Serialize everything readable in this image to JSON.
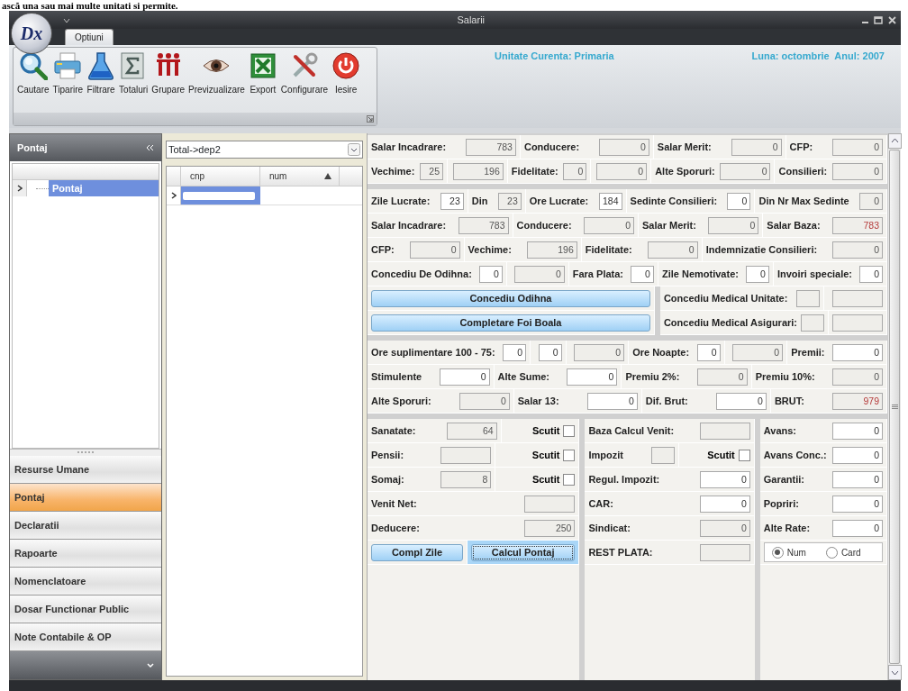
{
  "document_text": "ască una sau mai multe unitati si permite.",
  "window": {
    "title": "Salarii",
    "logo_text": "Dx"
  },
  "ribbon": {
    "tabs": [
      {
        "label": "Optiuni",
        "selected": true
      }
    ],
    "buttons": [
      "Cautare",
      "Tiparire",
      "Filtrare",
      "Totaluri",
      "Grupare",
      "Previzualizare",
      "Export",
      "Configurare",
      "Iesire"
    ],
    "unit": "Unitate Curenta: Primaria",
    "period": "Luna: octombrie  Anul: 2007"
  },
  "sidebar": {
    "title": "Pontaj",
    "tree": [
      {
        "label": "Pontaj",
        "selected": true
      }
    ],
    "nav": [
      {
        "label": "Resurse Umane",
        "selected": false
      },
      {
        "label": "Pontaj",
        "selected": true
      },
      {
        "label": "Declaratii",
        "selected": false
      },
      {
        "label": "Rapoarte",
        "selected": false
      },
      {
        "label": "Nomenclatoare",
        "selected": false
      },
      {
        "label": "Dosar Functionar Public",
        "selected": false
      },
      {
        "label": "Note Contabile & OP",
        "selected": false
      }
    ]
  },
  "list": {
    "filter": "Total->dep2",
    "columns": [
      "cnp",
      "num"
    ],
    "rows": [
      {
        "selected": true
      }
    ]
  },
  "form": {
    "sections": [
      {
        "blocks": [
          {
            "rows": [
              {
                "groups": [
                  {
                    "items": [
                      {
                        "kind": "label",
                        "text": "Salar Incadrare:"
                      },
                      {
                        "kind": "field",
                        "value": "783",
                        "readonly": true
                      }
                    ]
                  },
                  {
                    "items": [
                      {
                        "kind": "label",
                        "text": "Conducere:"
                      },
                      {
                        "kind": "field",
                        "value": "0",
                        "readonly": true
                      }
                    ]
                  },
                  {
                    "items": [
                      {
                        "kind": "label",
                        "text": "Salar Merit:"
                      },
                      {
                        "kind": "field",
                        "value": "0",
                        "readonly": true
                      }
                    ]
                  },
                  {
                    "items": [
                      {
                        "kind": "label",
                        "text": "CFP:"
                      },
                      {
                        "kind": "field",
                        "value": "0",
                        "readonly": true
                      }
                    ]
                  }
                ]
              },
              {
                "groups": [
                  {
                    "items": [
                      {
                        "kind": "label",
                        "text": "Vechime:"
                      },
                      {
                        "kind": "small_field",
                        "value": "25",
                        "readonly": true
                      }
                    ]
                  },
                  {
                    "items": [
                      {
                        "kind": "field",
                        "value": "196",
                        "readonly": true
                      }
                    ]
                  },
                  {
                    "items": [
                      {
                        "kind": "label",
                        "text": "Fidelitate:"
                      },
                      {
                        "kind": "small_field",
                        "value": "0",
                        "readonly": true
                      }
                    ]
                  },
                  {
                    "items": [
                      {
                        "kind": "field",
                        "value": "0",
                        "readonly": true
                      }
                    ]
                  },
                  {
                    "items": [
                      {
                        "kind": "label",
                        "text": "Alte Sporuri:"
                      },
                      {
                        "kind": "field",
                        "value": "0",
                        "readonly": true
                      }
                    ]
                  },
                  {
                    "items": [
                      {
                        "kind": "label",
                        "text": "Consilieri:"
                      },
                      {
                        "kind": "field",
                        "value": "0",
                        "readonly": true
                      }
                    ]
                  }
                ]
              }
            ]
          }
        ]
      },
      {
        "blocks": [
          {
            "rows": [
              {
                "groups": [
                  {
                    "items": [
                      {
                        "kind": "label",
                        "text": "Zile Lucrate:"
                      },
                      {
                        "kind": "small_field",
                        "value": "23",
                        "readonly": false
                      }
                    ]
                  },
                  {
                    "items": [
                      {
                        "kind": "label",
                        "text": "Din"
                      },
                      {
                        "kind": "small_field",
                        "value": "23",
                        "readonly": true
                      }
                    ]
                  },
                  {
                    "items": [
                      {
                        "kind": "label",
                        "text": "Ore Lucrate:"
                      },
                      {
                        "kind": "small_field",
                        "value": "184",
                        "readonly": false
                      }
                    ]
                  },
                  {
                    "items": [
                      {
                        "kind": "label",
                        "text": "Sedinte Consilieri:"
                      },
                      {
                        "kind": "small_field",
                        "value": "0",
                        "readonly": false
                      }
                    ]
                  },
                  {
                    "items": [
                      {
                        "kind": "label",
                        "text": "Din Nr Max Sedinte"
                      },
                      {
                        "kind": "small_field",
                        "value": "0",
                        "readonly": true
                      }
                    ]
                  }
                ]
              },
              {
                "groups": [
                  {
                    "items": [
                      {
                        "kind": "label",
                        "text": "Salar Incadrare:"
                      },
                      {
                        "kind": "field",
                        "value": "783",
                        "readonly": true
                      }
                    ]
                  },
                  {
                    "items": [
                      {
                        "kind": "label",
                        "text": "Conducere:"
                      },
                      {
                        "kind": "field",
                        "value": "0",
                        "readonly": true
                      }
                    ]
                  },
                  {
                    "items": [
                      {
                        "kind": "label",
                        "text": "Salar Merit:"
                      },
                      {
                        "kind": "field",
                        "value": "0",
                        "readonly": true
                      }
                    ]
                  },
                  {
                    "items": [
                      {
                        "kind": "label",
                        "text": "Salar Baza:"
                      },
                      {
                        "kind": "field",
                        "value": "783",
                        "readonly": true,
                        "emphasis": true
                      }
                    ]
                  }
                ]
              },
              {
                "groups": [
                  {
                    "items": [
                      {
                        "kind": "label",
                        "text": "CFP:"
                      },
                      {
                        "kind": "field",
                        "value": "0",
                        "readonly": true
                      }
                    ]
                  },
                  {
                    "items": [
                      {
                        "kind": "label",
                        "text": "Vechime:"
                      },
                      {
                        "kind": "field",
                        "value": "196",
                        "readonly": true
                      }
                    ]
                  },
                  {
                    "items": [
                      {
                        "kind": "label",
                        "text": "Fidelitate:"
                      },
                      {
                        "kind": "field",
                        "value": "0",
                        "readonly": true
                      }
                    ]
                  },
                  {
                    "items": [
                      {
                        "kind": "label",
                        "text": "Indemnizatie Consilieri:"
                      },
                      {
                        "kind": "field",
                        "value": "0",
                        "readonly": true
                      }
                    ]
                  }
                ]
              },
              {
                "groups": [
                  {
                    "items": [
                      {
                        "kind": "label",
                        "text": "Concediu De Odihna:"
                      },
                      {
                        "kind": "small_field",
                        "value": "0",
                        "readonly": false
                      }
                    ]
                  },
                  {
                    "items": [
                      {
                        "kind": "field",
                        "value": "0",
                        "readonly": true
                      }
                    ]
                  },
                  {
                    "items": [
                      {
                        "kind": "label",
                        "text": "Fara Plata:"
                      },
                      {
                        "kind": "small_field",
                        "value": "0",
                        "readonly": false
                      }
                    ]
                  },
                  {
                    "items": [
                      {
                        "kind": "label",
                        "text": "Zile Nemotivate:"
                      },
                      {
                        "kind": "small_field",
                        "value": "0",
                        "readonly": false
                      }
                    ]
                  },
                  {
                    "items": [
                      {
                        "kind": "label",
                        "text": "Invoiri speciale:"
                      },
                      {
                        "kind": "small_field",
                        "value": "0",
                        "readonly": false
                      }
                    ]
                  }
                ]
              }
            ]
          },
          {
            "columns": [
              {
                "rows": [
                  {
                    "groups": [
                      {
                        "items": [
                          {
                            "kind": "button",
                            "label": "Concediu Odihna",
                            "focused": false
                          }
                        ]
                      }
                    ]
                  },
                  {
                    "groups": [
                      {
                        "items": [
                          {
                            "kind": "button",
                            "label": "Completare Foi Boala",
                            "focused": false
                          }
                        ]
                      }
                    ]
                  }
                ]
              },
              {
                "rows": [
                  {
                    "groups": [
                      {
                        "items": [
                          {
                            "kind": "label",
                            "text": "Concediu Medical Unitate:"
                          },
                          {
                            "kind": "small_field",
                            "readonly": true
                          }
                        ]
                      },
                      {
                        "items": [
                          {
                            "kind": "field",
                            "readonly": true
                          }
                        ]
                      }
                    ]
                  },
                  {
                    "groups": [
                      {
                        "items": [
                          {
                            "kind": "label",
                            "text": "Concediu Medical Asigurari:"
                          },
                          {
                            "kind": "small_field",
                            "readonly": true
                          }
                        ]
                      },
                      {
                        "items": [
                          {
                            "kind": "field",
                            "readonly": true
                          }
                        ]
                      }
                    ]
                  }
                ]
              }
            ]
          }
        ]
      },
      {
        "blocks": [
          {
            "rows": [
              {
                "groups": [
                  {
                    "items": [
                      {
                        "kind": "label",
                        "text": "Ore suplimentare 100 - 75:"
                      },
                      {
                        "kind": "small_field",
                        "value": "0",
                        "readonly": false
                      }
                    ]
                  },
                  {
                    "items": [
                      {
                        "kind": "small_field",
                        "value": "0",
                        "readonly": false
                      }
                    ]
                  },
                  {
                    "items": [
                      {
                        "kind": "field",
                        "value": "0",
                        "readonly": true
                      }
                    ]
                  },
                  {
                    "items": [
                      {
                        "kind": "label",
                        "text": "Ore Noapte:"
                      },
                      {
                        "kind": "small_field",
                        "value": "0",
                        "readonly": false
                      }
                    ]
                  },
                  {
                    "items": [
                      {
                        "kind": "field",
                        "value": "0",
                        "readonly": true
                      }
                    ]
                  },
                  {
                    "items": [
                      {
                        "kind": "label",
                        "text": "Premii:"
                      },
                      {
                        "kind": "field",
                        "value": "0",
                        "readonly": false
                      }
                    ]
                  }
                ]
              },
              {
                "groups": [
                  {
                    "items": [
                      {
                        "kind": "label",
                        "text": "Stimulente"
                      },
                      {
                        "kind": "field",
                        "value": "0",
                        "readonly": false
                      }
                    ]
                  },
                  {
                    "items": [
                      {
                        "kind": "label",
                        "text": "Alte Sume:"
                      },
                      {
                        "kind": "field",
                        "value": "0",
                        "readonly": false
                      }
                    ]
                  },
                  {
                    "items": [
                      {
                        "kind": "label",
                        "text": "Premiu 2%:"
                      },
                      {
                        "kind": "field",
                        "value": "0",
                        "readonly": true
                      }
                    ]
                  },
                  {
                    "items": [
                      {
                        "kind": "label",
                        "text": "Premiu 10%:"
                      },
                      {
                        "kind": "field",
                        "value": "0",
                        "readonly": true
                      }
                    ]
                  }
                ]
              },
              {
                "groups": [
                  {
                    "items": [
                      {
                        "kind": "label",
                        "text": "Alte Sporuri:"
                      },
                      {
                        "kind": "field",
                        "value": "0",
                        "readonly": true
                      }
                    ]
                  },
                  {
                    "items": [
                      {
                        "kind": "label",
                        "text": "Salar 13:"
                      },
                      {
                        "kind": "field",
                        "value": "0",
                        "readonly": false
                      }
                    ]
                  },
                  {
                    "items": [
                      {
                        "kind": "label",
                        "text": "Dif. Brut:"
                      },
                      {
                        "kind": "field",
                        "value": "0",
                        "readonly": false
                      }
                    ]
                  },
                  {
                    "items": [
                      {
                        "kind": "label",
                        "text": "BRUT:"
                      },
                      {
                        "kind": "field",
                        "value": "979",
                        "readonly": true,
                        "emphasis": true
                      }
                    ]
                  }
                ]
              }
            ]
          }
        ]
      },
      {
        "blocks": [
          {
            "columns": [
              {
                "rows": [
                  {
                    "groups": [
                      {
                        "items": [
                          {
                            "kind": "label",
                            "text": "Sanatate:"
                          },
                          {
                            "kind": "field",
                            "value": "64",
                            "readonly": true
                          }
                        ]
                      },
                      {
                        "items": [
                          {
                            "kind": "checkbox",
                            "label": "Scutit",
                            "checked": false
                          }
                        ]
                      }
                    ]
                  },
                  {
                    "groups": [
                      {
                        "items": [
                          {
                            "kind": "label",
                            "text": "Pensii:"
                          },
                          {
                            "kind": "field",
                            "readonly": true
                          }
                        ]
                      },
                      {
                        "items": [
                          {
                            "kind": "checkbox",
                            "label": "Scutit",
                            "checked": false
                          }
                        ]
                      }
                    ]
                  },
                  {
                    "groups": [
                      {
                        "items": [
                          {
                            "kind": "label",
                            "text": "Somaj:"
                          },
                          {
                            "kind": "field",
                            "value": "8",
                            "readonly": true
                          }
                        ]
                      },
                      {
                        "items": [
                          {
                            "kind": "checkbox",
                            "label": "Scutit",
                            "checked": false
                          }
                        ]
                      }
                    ]
                  },
                  {
                    "groups": [
                      {
                        "items": [
                          {
                            "kind": "label",
                            "text": "Venit Net:"
                          },
                          {
                            "kind": "field",
                            "readonly": true
                          }
                        ]
                      }
                    ]
                  },
                  {
                    "groups": [
                      {
                        "items": [
                          {
                            "kind": "label",
                            "text": "Deducere:"
                          },
                          {
                            "kind": "field",
                            "value": "250",
                            "readonly": true
                          }
                        ]
                      }
                    ]
                  },
                  {
                    "groups": [
                      {
                        "items": [
                          {
                            "kind": "button",
                            "label": "Compl Zile",
                            "focused": false
                          }
                        ]
                      },
                      {
                        "items": [
                          {
                            "kind": "button",
                            "label": "Calcul Pontaj",
                            "focused": true
                          }
                        ]
                      }
                    ]
                  }
                ]
              },
              {
                "rows": [
                  {
                    "groups": [
                      {
                        "items": [
                          {
                            "kind": "label",
                            "text": "Baza Calcul Venit:"
                          },
                          {
                            "kind": "field",
                            "readonly": true
                          }
                        ]
                      }
                    ]
                  },
                  {
                    "groups": [
                      {
                        "items": [
                          {
                            "kind": "label",
                            "text": "Impozit"
                          },
                          {
                            "kind": "small_field",
                            "readonly": true
                          }
                        ]
                      },
                      {
                        "items": [
                          {
                            "kind": "checkbox",
                            "label": "Scutit",
                            "checked": false
                          }
                        ]
                      }
                    ]
                  },
                  {
                    "groups": [
                      {
                        "items": [
                          {
                            "kind": "label",
                            "text": "Regul. Impozit:"
                          },
                          {
                            "kind": "field",
                            "value": "0",
                            "readonly": false
                          }
                        ]
                      }
                    ]
                  },
                  {
                    "groups": [
                      {
                        "items": [
                          {
                            "kind": "label",
                            "text": "CAR:"
                          },
                          {
                            "kind": "field",
                            "value": "0",
                            "readonly": false
                          }
                        ]
                      }
                    ]
                  },
                  {
                    "groups": [
                      {
                        "items": [
                          {
                            "kind": "label",
                            "text": "Sindicat:"
                          },
                          {
                            "kind": "field",
                            "value": "0",
                            "readonly": true
                          }
                        ]
                      }
                    ]
                  },
                  {
                    "groups": [
                      {
                        "items": [
                          {
                            "kind": "label",
                            "text": "REST PLATA:"
                          },
                          {
                            "kind": "field",
                            "readonly": true
                          }
                        ]
                      }
                    ]
                  }
                ]
              },
              {
                "rows": [
                  {
                    "groups": [
                      {
                        "items": [
                          {
                            "kind": "label",
                            "text": "Avans:"
                          },
                          {
                            "kind": "field",
                            "value": "0",
                            "readonly": false
                          }
                        ]
                      }
                    ]
                  },
                  {
                    "groups": [
                      {
                        "items": [
                          {
                            "kind": "label",
                            "text": "Avans Conc.:"
                          },
                          {
                            "kind": "field",
                            "value": "0",
                            "readonly": false
                          }
                        ]
                      }
                    ]
                  },
                  {
                    "groups": [
                      {
                        "items": [
                          {
                            "kind": "label",
                            "text": "Garantii:"
                          },
                          {
                            "kind": "field",
                            "value": "0",
                            "readonly": false
                          }
                        ]
                      }
                    ]
                  },
                  {
                    "groups": [
                      {
                        "items": [
                          {
                            "kind": "label",
                            "text": "Popriri:"
                          },
                          {
                            "kind": "field",
                            "value": "0",
                            "readonly": false
                          }
                        ]
                      }
                    ]
                  },
                  {
                    "groups": [
                      {
                        "items": [
                          {
                            "kind": "label",
                            "text": "Alte Rate:"
                          },
                          {
                            "kind": "field",
                            "value": "0",
                            "readonly": false
                          }
                        ]
                      }
                    ]
                  },
                  {
                    "groups": [
                      {
                        "items": [
                          {
                            "kind": "radio",
                            "label": "Num",
                            "selected": true
                          },
                          {
                            "kind": "radio",
                            "label": "Card",
                            "selected": false
                          }
                        ]
                      }
                    ]
                  }
                ]
              }
            ]
          }
        ]
      }
    ]
  }
}
